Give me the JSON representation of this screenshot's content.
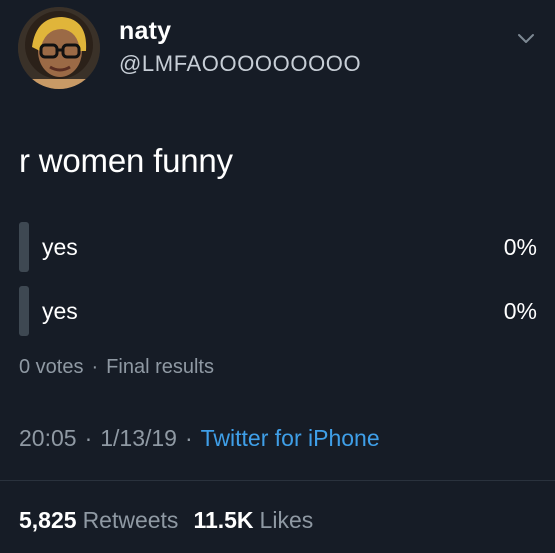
{
  "author": {
    "display_name": "naty",
    "handle": "@LMFAOOOOOOOOO"
  },
  "tweet": {
    "text": "r women funny"
  },
  "poll": {
    "options": [
      {
        "label": "yes",
        "percent": "0%"
      },
      {
        "label": "yes",
        "percent": "0%"
      }
    ],
    "votes": "0 votes",
    "separator": "·",
    "status": "Final results"
  },
  "meta": {
    "time": "20:05",
    "date": "1/13/19",
    "separator": "·",
    "source": "Twitter for iPhone"
  },
  "stats": {
    "retweets_count": "5,825",
    "retweets_label": "Retweets",
    "likes_count": "11.5K",
    "likes_label": "Likes"
  },
  "icons": {
    "menu": "chevron-down-icon"
  },
  "colors": {
    "background": "#161c26",
    "link": "#3f9fe8",
    "muted": "#8f99a3",
    "poll_bar": "#3e4852"
  }
}
